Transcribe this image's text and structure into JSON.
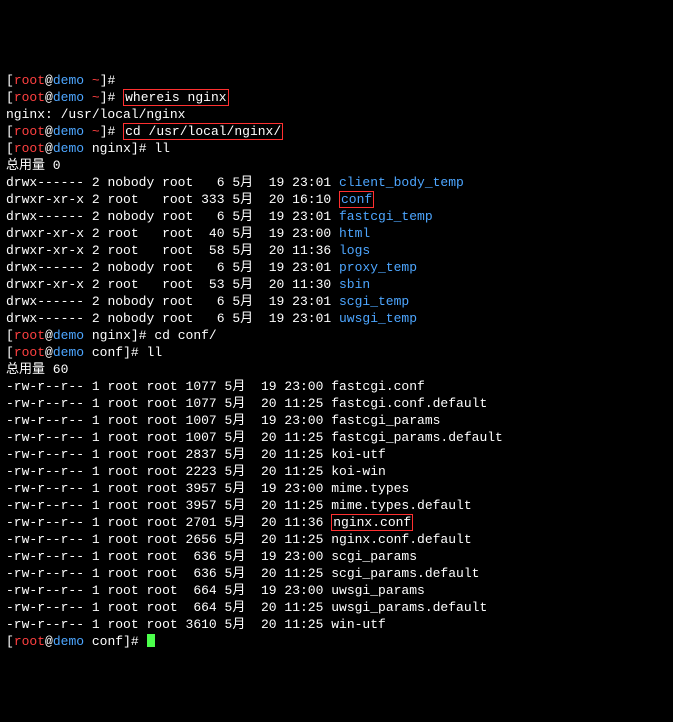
{
  "prompts": {
    "p0": {
      "u": "root",
      "h": "demo",
      "d": "~",
      "s": "#",
      "c": ""
    },
    "p1": {
      "u": "root",
      "h": "demo",
      "d": "~",
      "s": "#",
      "c": "whereis nginx"
    },
    "p2": {
      "u": "root",
      "h": "demo",
      "d": "~",
      "s": "#",
      "c": "cd /usr/local/nginx/"
    },
    "p3": {
      "u": "root",
      "h": "demo",
      "d": "nginx",
      "s": "#",
      "c": "ll"
    },
    "p4": {
      "u": "root",
      "h": "demo",
      "d": "nginx",
      "s": "#",
      "c": "cd conf/"
    },
    "p5": {
      "u": "root",
      "h": "demo",
      "d": "conf",
      "s": "#",
      "c": "ll"
    },
    "p6": {
      "u": "root",
      "h": "demo",
      "d": "conf",
      "s": "#",
      "c": ""
    }
  },
  "whereis_out": "nginx: /usr/local/nginx",
  "totals": {
    "t1": "总用量 0",
    "t2": "总用量 60"
  },
  "ls1": [
    {
      "perm": "drwx------",
      "ln": "2",
      "own": "nobody",
      "grp": "root",
      "size": "6",
      "mon": "5月",
      "day": "19",
      "time": "23:01",
      "name": "client_body_temp",
      "dir": true,
      "hl": false
    },
    {
      "perm": "drwxr-xr-x",
      "ln": "2",
      "own": "root",
      "grp": "root",
      "size": "333",
      "mon": "5月",
      "day": "20",
      "time": "16:10",
      "name": "conf",
      "dir": true,
      "hl": true
    },
    {
      "perm": "drwx------",
      "ln": "2",
      "own": "nobody",
      "grp": "root",
      "size": "6",
      "mon": "5月",
      "day": "19",
      "time": "23:01",
      "name": "fastcgi_temp",
      "dir": true,
      "hl": false
    },
    {
      "perm": "drwxr-xr-x",
      "ln": "2",
      "own": "root",
      "grp": "root",
      "size": "40",
      "mon": "5月",
      "day": "19",
      "time": "23:00",
      "name": "html",
      "dir": true,
      "hl": false
    },
    {
      "perm": "drwxr-xr-x",
      "ln": "2",
      "own": "root",
      "grp": "root",
      "size": "58",
      "mon": "5月",
      "day": "20",
      "time": "11:36",
      "name": "logs",
      "dir": true,
      "hl": false
    },
    {
      "perm": "drwx------",
      "ln": "2",
      "own": "nobody",
      "grp": "root",
      "size": "6",
      "mon": "5月",
      "day": "19",
      "time": "23:01",
      "name": "proxy_temp",
      "dir": true,
      "hl": false
    },
    {
      "perm": "drwxr-xr-x",
      "ln": "2",
      "own": "root",
      "grp": "root",
      "size": "53",
      "mon": "5月",
      "day": "20",
      "time": "11:30",
      "name": "sbin",
      "dir": true,
      "hl": false
    },
    {
      "perm": "drwx------",
      "ln": "2",
      "own": "nobody",
      "grp": "root",
      "size": "6",
      "mon": "5月",
      "day": "19",
      "time": "23:01",
      "name": "scgi_temp",
      "dir": true,
      "hl": false
    },
    {
      "perm": "drwx------",
      "ln": "2",
      "own": "nobody",
      "grp": "root",
      "size": "6",
      "mon": "5月",
      "day": "19",
      "time": "23:01",
      "name": "uwsgi_temp",
      "dir": true,
      "hl": false
    }
  ],
  "ls2": [
    {
      "perm": "-rw-r--r--",
      "ln": "1",
      "own": "root",
      "grp": "root",
      "size": "1077",
      "mon": "5月",
      "day": "19",
      "time": "23:00",
      "name": "fastcgi.conf",
      "dir": false,
      "hl": false
    },
    {
      "perm": "-rw-r--r--",
      "ln": "1",
      "own": "root",
      "grp": "root",
      "size": "1077",
      "mon": "5月",
      "day": "20",
      "time": "11:25",
      "name": "fastcgi.conf.default",
      "dir": false,
      "hl": false
    },
    {
      "perm": "-rw-r--r--",
      "ln": "1",
      "own": "root",
      "grp": "root",
      "size": "1007",
      "mon": "5月",
      "day": "19",
      "time": "23:00",
      "name": "fastcgi_params",
      "dir": false,
      "hl": false
    },
    {
      "perm": "-rw-r--r--",
      "ln": "1",
      "own": "root",
      "grp": "root",
      "size": "1007",
      "mon": "5月",
      "day": "20",
      "time": "11:25",
      "name": "fastcgi_params.default",
      "dir": false,
      "hl": false
    },
    {
      "perm": "-rw-r--r--",
      "ln": "1",
      "own": "root",
      "grp": "root",
      "size": "2837",
      "mon": "5月",
      "day": "20",
      "time": "11:25",
      "name": "koi-utf",
      "dir": false,
      "hl": false
    },
    {
      "perm": "-rw-r--r--",
      "ln": "1",
      "own": "root",
      "grp": "root",
      "size": "2223",
      "mon": "5月",
      "day": "20",
      "time": "11:25",
      "name": "koi-win",
      "dir": false,
      "hl": false
    },
    {
      "perm": "-rw-r--r--",
      "ln": "1",
      "own": "root",
      "grp": "root",
      "size": "3957",
      "mon": "5月",
      "day": "19",
      "time": "23:00",
      "name": "mime.types",
      "dir": false,
      "hl": false
    },
    {
      "perm": "-rw-r--r--",
      "ln": "1",
      "own": "root",
      "grp": "root",
      "size": "3957",
      "mon": "5月",
      "day": "20",
      "time": "11:25",
      "name": "mime.types.default",
      "dir": false,
      "hl": false
    },
    {
      "perm": "-rw-r--r--",
      "ln": "1",
      "own": "root",
      "grp": "root",
      "size": "2701",
      "mon": "5月",
      "day": "20",
      "time": "11:36",
      "name": "nginx.conf",
      "dir": false,
      "hl": true
    },
    {
      "perm": "-rw-r--r--",
      "ln": "1",
      "own": "root",
      "grp": "root",
      "size": "2656",
      "mon": "5月",
      "day": "20",
      "time": "11:25",
      "name": "nginx.conf.default",
      "dir": false,
      "hl": false
    },
    {
      "perm": "-rw-r--r--",
      "ln": "1",
      "own": "root",
      "grp": "root",
      "size": "636",
      "mon": "5月",
      "day": "19",
      "time": "23:00",
      "name": "scgi_params",
      "dir": false,
      "hl": false
    },
    {
      "perm": "-rw-r--r--",
      "ln": "1",
      "own": "root",
      "grp": "root",
      "size": "636",
      "mon": "5月",
      "day": "20",
      "time": "11:25",
      "name": "scgi_params.default",
      "dir": false,
      "hl": false
    },
    {
      "perm": "-rw-r--r--",
      "ln": "1",
      "own": "root",
      "grp": "root",
      "size": "664",
      "mon": "5月",
      "day": "19",
      "time": "23:00",
      "name": "uwsgi_params",
      "dir": false,
      "hl": false
    },
    {
      "perm": "-rw-r--r--",
      "ln": "1",
      "own": "root",
      "grp": "root",
      "size": "664",
      "mon": "5月",
      "day": "20",
      "time": "11:25",
      "name": "uwsgi_params.default",
      "dir": false,
      "hl": false
    },
    {
      "perm": "-rw-r--r--",
      "ln": "1",
      "own": "root",
      "grp": "root",
      "size": "3610",
      "mon": "5月",
      "day": "20",
      "time": "11:25",
      "name": "win-utf",
      "dir": false,
      "hl": false
    }
  ]
}
